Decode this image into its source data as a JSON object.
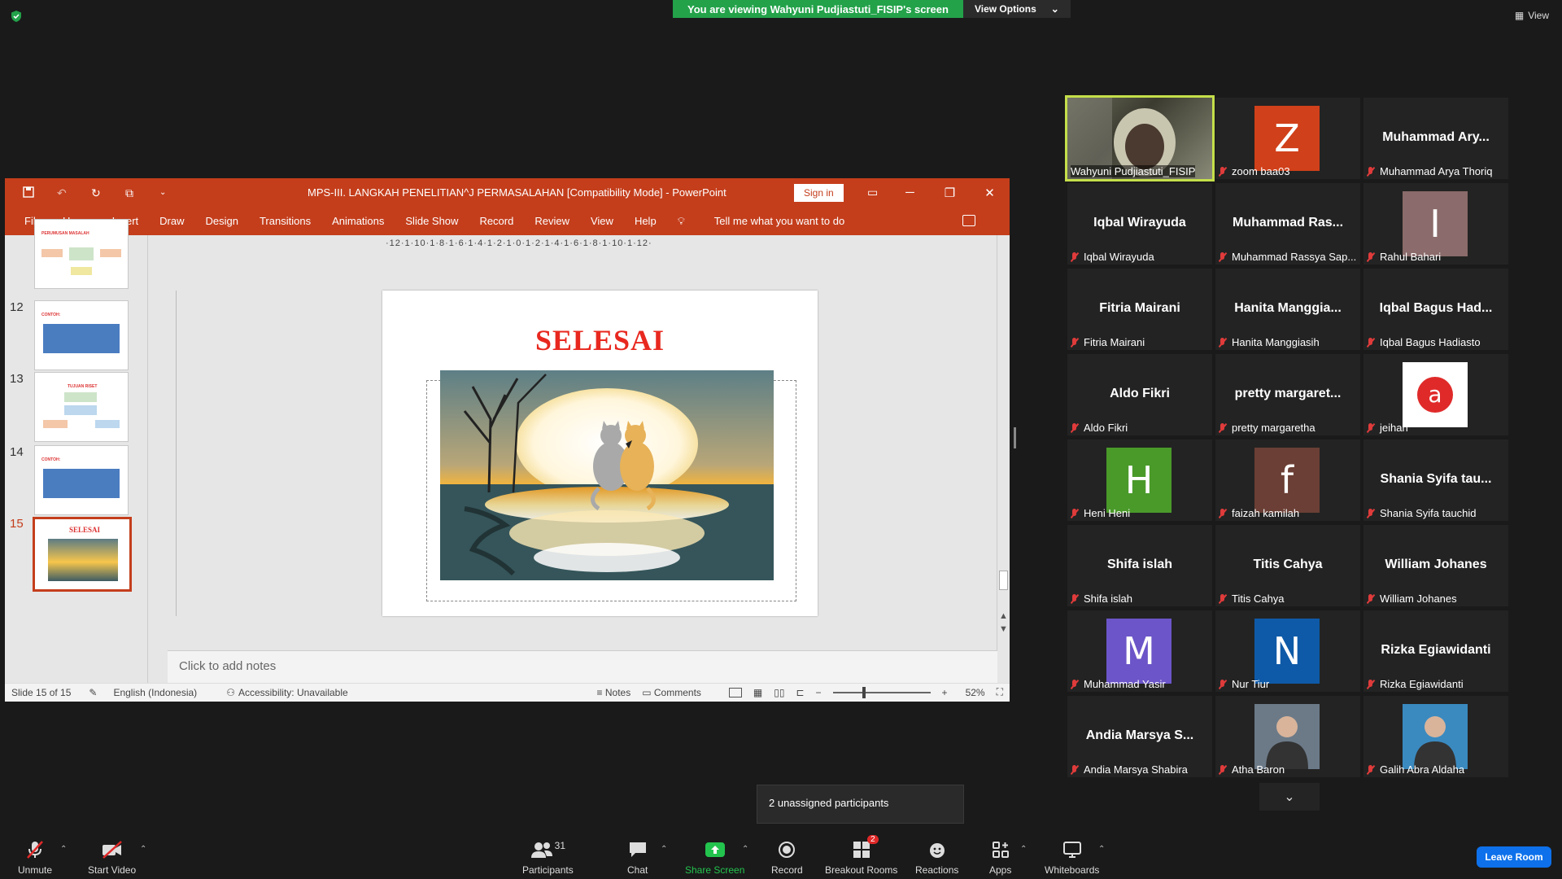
{
  "banner": {
    "sharing_text": "You are viewing Wahyuni Pudjiastuti_FISIP's screen",
    "view_options": "View Options",
    "view": "View"
  },
  "ppt": {
    "title": "MPS-III. LANGKAH PENELITIAN^J PERMASALAHAN [Compatibility Mode]  -  PowerPoint",
    "sign_in": "Sign in",
    "menu": [
      "File",
      "Home",
      "Insert",
      "Draw",
      "Design",
      "Transitions",
      "Animations",
      "Slide Show",
      "Record",
      "Review",
      "View",
      "Help"
    ],
    "tell_me": "Tell me what you want to do",
    "ruler": "·12·1·10·1·8·1·6·1·4·1·2·1·0·1·2·1·4·1·6·1·8·1·10·1·12·",
    "thumbnails": [
      {
        "num": "",
        "title": "PERUMUSAN MASALAH"
      },
      {
        "num": "12",
        "title": "CONTOH:"
      },
      {
        "num": "13",
        "title": "TUJUAN RISET"
      },
      {
        "num": "14",
        "title": "CONTOH:"
      },
      {
        "num": "15",
        "title": "SELESAI"
      }
    ],
    "slide_title": "SELESAI",
    "notes_placeholder": "Click to add notes",
    "status": {
      "slide": "Slide 15 of 15",
      "language": "English (Indonesia)",
      "accessibility": "Accessibility: Unavailable",
      "notes": "Notes",
      "comments": "Comments",
      "zoom": "52%"
    }
  },
  "participants": [
    {
      "big": "",
      "label": "Wahyuni Pudjiastuti_FISIP",
      "avatar": "",
      "avatar_color": "",
      "speaker": true,
      "muted": false
    },
    {
      "big": "",
      "label": "zoom baa03",
      "avatar": "Z",
      "avatar_color": "#d0401a",
      "muted": true
    },
    {
      "big": "Muhammad Ary...",
      "label": "Muhammad Arya Thoriq",
      "avatar": "",
      "muted": true
    },
    {
      "big": "Iqbal Wirayuda",
      "label": "Iqbal Wirayuda",
      "avatar": "",
      "muted": true
    },
    {
      "big": "Muhammad Ras...",
      "label": "Muhammad Rassya Sap...",
      "avatar": "",
      "muted": true
    },
    {
      "big": "",
      "label": "Rahul Bahari",
      "avatar": "I",
      "avatar_color": "#8b6b6b",
      "muted": true
    },
    {
      "big": "Fitria Mairani",
      "label": "Fitria Mairani",
      "avatar": "",
      "muted": true
    },
    {
      "big": "Hanita  Manggia...",
      "label": "Hanita  Manggiasih",
      "avatar": "",
      "muted": true
    },
    {
      "big": "Iqbal Bagus Had...",
      "label": "Iqbal Bagus Hadiasto",
      "avatar": "",
      "muted": true
    },
    {
      "big": "Aldo Fikri",
      "label": "Aldo Fikri",
      "avatar": "",
      "muted": true
    },
    {
      "big": "pretty  margaret...",
      "label": "pretty margaretha",
      "avatar": "",
      "muted": true
    },
    {
      "big": "",
      "label": "jeihan",
      "avatar": "a",
      "avatar_color": "#ffffff",
      "muted": true
    },
    {
      "big": "",
      "label": "Heni Heni",
      "avatar": "H",
      "avatar_color": "#4a9a2a",
      "muted": true
    },
    {
      "big": "",
      "label": "faizah kamilah",
      "avatar": "f",
      "avatar_color": "#6b3f35",
      "muted": true
    },
    {
      "big": "Shania Syifa tau...",
      "label": "Shania Syifa tauchid",
      "avatar": "",
      "muted": true
    },
    {
      "big": "Shifa islah",
      "label": "Shifa islah",
      "avatar": "",
      "muted": true
    },
    {
      "big": "Titis Cahya",
      "label": "Titis Cahya",
      "avatar": "",
      "muted": true
    },
    {
      "big": "William Johanes",
      "label": "William Johanes",
      "avatar": "",
      "muted": true
    },
    {
      "big": "",
      "label": "Muhammad Yasir",
      "avatar": "M",
      "avatar_color": "#6b55c8",
      "muted": true
    },
    {
      "big": "",
      "label": "Nur Tiur",
      "avatar": "N",
      "avatar_color": "#0e5aa8",
      "muted": true
    },
    {
      "big": "Rizka Egiawidanti",
      "label": "Rizka Egiawidanti",
      "avatar": "",
      "muted": true
    },
    {
      "big": "Andia Marsya S...",
      "label": "Andia Marsya Shabira",
      "avatar": "",
      "muted": true
    },
    {
      "big": "",
      "label": "Atha Baron",
      "avatar": "photo",
      "avatar_color": "#6c7a88",
      "muted": true
    },
    {
      "big": "",
      "label": "Galih Abra Aldaha",
      "avatar": "photo",
      "avatar_color": "#3a8ac0",
      "muted": true
    }
  ],
  "unassigned": "2 unassigned participants",
  "toolbar": {
    "unmute": "Unmute",
    "start_video": "Start Video",
    "participants": "Participants",
    "participants_count": "31",
    "chat": "Chat",
    "share_screen": "Share Screen",
    "record": "Record",
    "breakout": "Breakout Rooms",
    "breakout_badge": "2",
    "reactions": "Reactions",
    "apps": "Apps",
    "whiteboards": "Whiteboards",
    "leave": "Leave Room"
  }
}
